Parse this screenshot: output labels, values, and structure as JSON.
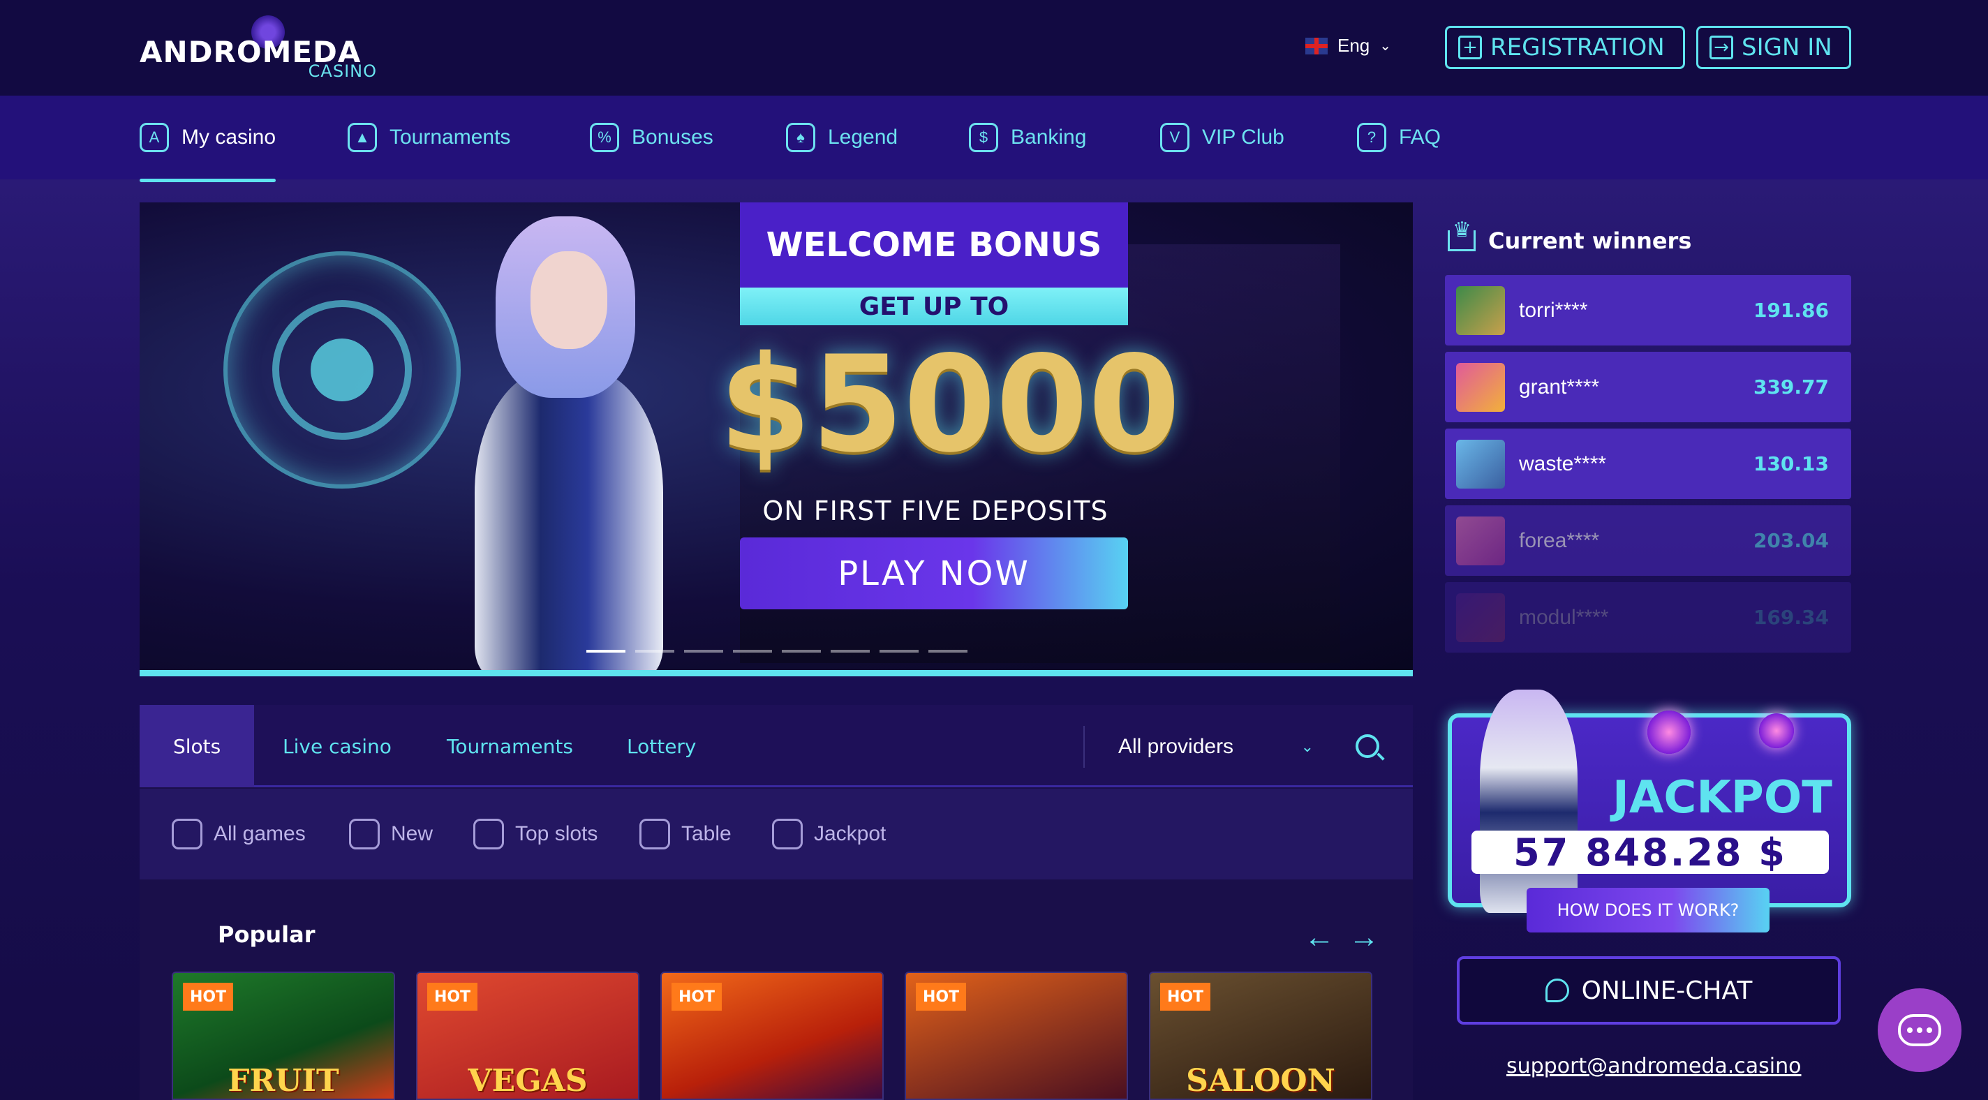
{
  "brand": {
    "name": "ANDROMEDA",
    "sub": "CASINO"
  },
  "header": {
    "language": "Eng",
    "registration": "REGISTRATION",
    "signin": "SIGN IN"
  },
  "nav": [
    {
      "label": "My casino",
      "icon": "my-casino-icon",
      "active": true
    },
    {
      "label": "Tournaments",
      "icon": "tournaments-icon"
    },
    {
      "label": "Bonuses",
      "icon": "bonuses-icon"
    },
    {
      "label": "Legend",
      "icon": "legend-icon"
    },
    {
      "label": "Banking",
      "icon": "banking-icon"
    },
    {
      "label": "VIP Club",
      "icon": "vip-club-icon"
    },
    {
      "label": "FAQ",
      "icon": "faq-icon"
    }
  ],
  "banner": {
    "title": "WELCOME BONUS",
    "subtitle": "GET UP TO",
    "amount": "$5000",
    "deposits": "ON FIRST FIVE DEPOSITS",
    "cta": "PLAY NOW",
    "slide_count": 8,
    "active_slide": 1
  },
  "winners": {
    "title": "Current winners",
    "rows": [
      {
        "name": "torri****",
        "amount": "191.86",
        "opacity": 1.0
      },
      {
        "name": "grant****",
        "amount": "339.77",
        "opacity": 1.0
      },
      {
        "name": "waste****",
        "amount": "130.13",
        "opacity": 1.0
      },
      {
        "name": "forea****",
        "amount": "203.04",
        "opacity": 0.55
      },
      {
        "name": "modul****",
        "amount": "169.34",
        "opacity": 0.25
      }
    ]
  },
  "jackpot": {
    "title": "JACKPOT",
    "value": "57 848.28 $",
    "how": "HOW DOES IT WORK?"
  },
  "support": {
    "chat": "ONLINE-CHAT",
    "email": "support@andromeda.casino"
  },
  "games": {
    "tabs": [
      "Slots",
      "Live casino",
      "Tournaments",
      "Lottery"
    ],
    "active_tab": "Slots",
    "providers": "All providers",
    "categories": [
      {
        "label": "All games",
        "icon": "all-games-icon"
      },
      {
        "label": "New",
        "icon": "new-icon"
      },
      {
        "label": "Top slots",
        "icon": "top-slots-icon"
      },
      {
        "label": "Table",
        "icon": "table-icon"
      },
      {
        "label": "Jackpot",
        "icon": "jackpot-icon"
      }
    ],
    "section_title": "Popular",
    "badge": "HOT",
    "cards": [
      {
        "label": "FRUIT"
      },
      {
        "label": "VEGAS"
      },
      {
        "label": ""
      },
      {
        "label": ""
      },
      {
        "label": "SALOON"
      }
    ]
  },
  "colors": {
    "accent": "#5fe3ef",
    "nav_bg": "#23117a",
    "hot": "#ff7a1a"
  }
}
